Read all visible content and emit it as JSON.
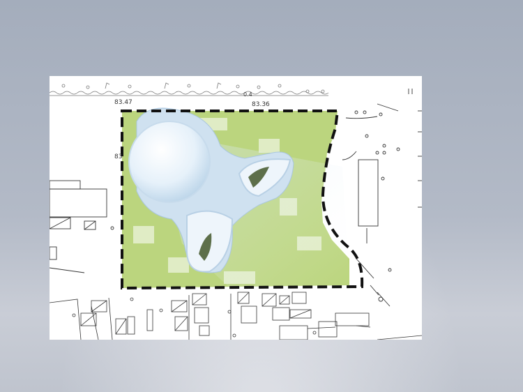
{
  "plan": {
    "elevation_labels": [
      "83.47",
      "83.36",
      "83",
      "0.4"
    ],
    "colors": {
      "background_top": "#a4adbc",
      "sheet": "#ffffff",
      "site_boundary": "#111111",
      "green_area": "#a8c95a",
      "building_volume": "#dcecf8",
      "building_shadow": "#7fa8c9"
    },
    "icons": [
      "map-plan",
      "site-boundary",
      "building-volume"
    ]
  }
}
